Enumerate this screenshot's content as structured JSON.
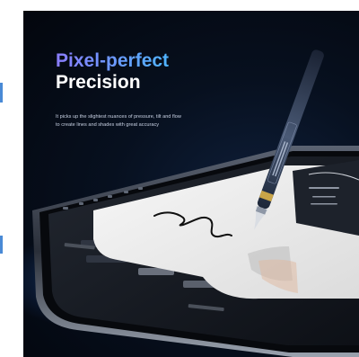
{
  "headline": {
    "line1": "Pixel-perfect",
    "line2": "Precision"
  },
  "description": {
    "line1": "It picks up the slightest nuances of pressure, tilt and flow",
    "line2": "to create lines and shades with great accuracy"
  },
  "colors": {
    "background": "#05090f",
    "headline_gradient_start": "#8a7dff",
    "headline_gradient_end": "#4fb4ff",
    "headline_secondary": "#ffffff",
    "stylus_body": "#2b3a52",
    "stylus_band": "#c9a548"
  }
}
